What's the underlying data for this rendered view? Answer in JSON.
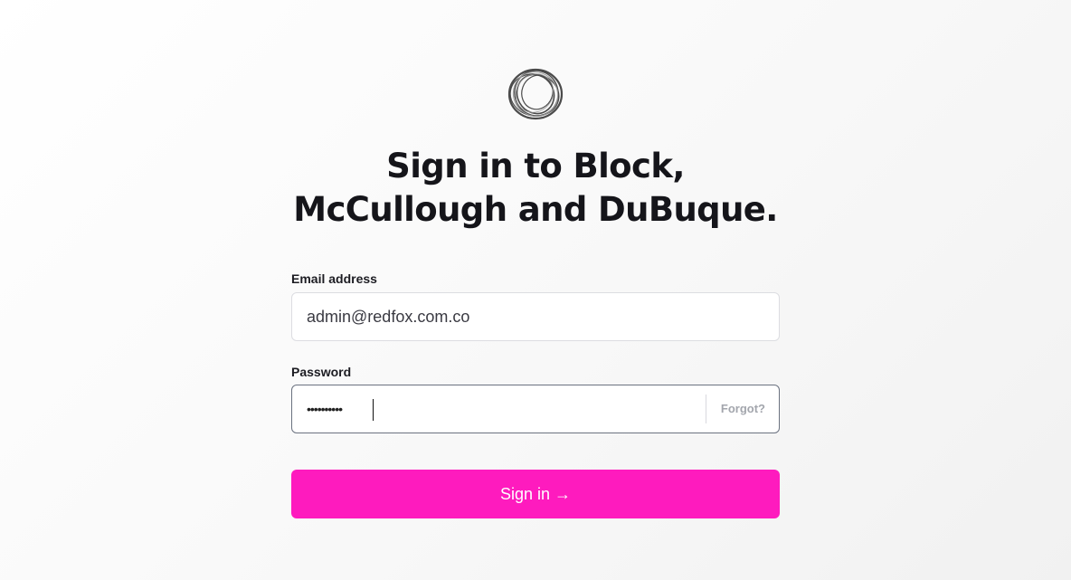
{
  "logo": {
    "icon": "ring-logo-icon",
    "color": "#555555"
  },
  "heading": {
    "line1": "Sign in to Block,",
    "line2": "McCullough and DuBuque."
  },
  "email": {
    "label": "Email address",
    "value": "admin@redfox.com.co"
  },
  "password": {
    "label": "Password",
    "masked_value": "••••••••••",
    "forgot_label": "Forgot?"
  },
  "submit": {
    "label": "Sign in →",
    "color": "#fe1bbe"
  }
}
